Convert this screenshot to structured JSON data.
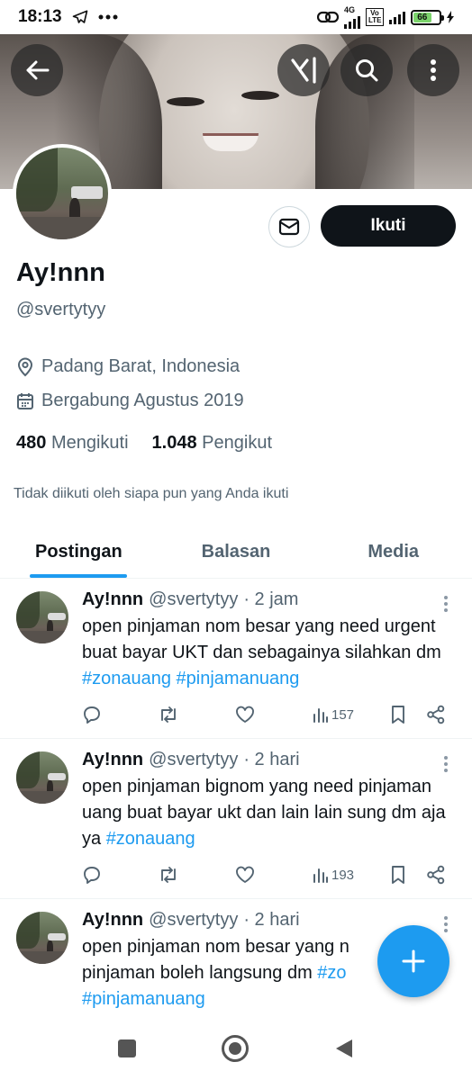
{
  "status_bar": {
    "time": "18:13",
    "network": "4G",
    "volte": "Vo LTE",
    "battery": "66"
  },
  "profile": {
    "display_name": "Ay!nnn",
    "handle": "@svertytyy",
    "location": "Padang Barat, Indonesia",
    "joined": "Bergabung Agustus 2019",
    "following_count": "480",
    "following_label": "Mengikuti",
    "followers_count": "1.048",
    "followers_label": "Pengikut",
    "follow_button": "Ikuti",
    "not_followed_note": "Tidak diikuti oleh siapa pun yang Anda ikuti"
  },
  "tabs": [
    {
      "label": "Postingan",
      "active": true
    },
    {
      "label": "Balasan",
      "active": false
    },
    {
      "label": "Media",
      "active": false
    }
  ],
  "tweets": [
    {
      "name": "Ay!nnn",
      "handle": "@svertytyy",
      "time": "· 2 jam",
      "text_plain": "open pinjaman nom besar yang need urgent buat bayar UKT dan sebagainya silahkan dm",
      "tags": [
        "#zonauang",
        "#pinjamanuang"
      ],
      "views": "157"
    },
    {
      "name": "Ay!nnn",
      "handle": "@svertytyy",
      "time": "· 2 hari",
      "text_plain": "open pinjaman bignom yang need pinjaman uang buat bayar ukt dan lain lain sung dm aja ya",
      "tags": [
        "#zonauang"
      ],
      "views": "193"
    },
    {
      "name": "Ay!nnn",
      "handle": "@svertytyy",
      "time": "· 2 hari",
      "text_plain": "open pinjaman nom besar yang n pinjaman boleh langsung dm",
      "tags": [
        "#zo",
        "#pinjamanuang"
      ],
      "views": ""
    }
  ],
  "icons": {
    "back": "arrow-left-icon",
    "grok": "grok-icon",
    "search": "search-icon",
    "more": "more-vertical-icon",
    "message": "envelope-icon",
    "location": "location-pin-icon",
    "calendar": "calendar-icon",
    "reply": "reply-icon",
    "retweet": "retweet-icon",
    "like": "heart-icon",
    "views": "views-icon",
    "bookmark": "bookmark-icon",
    "share": "share-icon",
    "compose": "plus-icon"
  },
  "colors": {
    "accent": "#1d9bf0",
    "text_primary": "#0f1419",
    "text_secondary": "#536471",
    "follow_bg": "#0f1419"
  }
}
